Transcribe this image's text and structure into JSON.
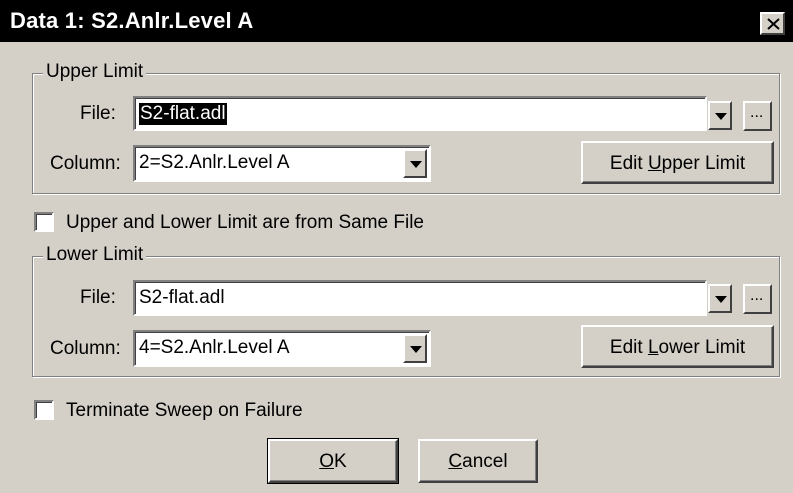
{
  "window": {
    "title": "Data 1: S2.Anlr.Level A",
    "close_icon": "close-icon"
  },
  "upper_limit": {
    "group_title": "Upper Limit",
    "file_label": "File:",
    "file_value": "S2-flat.adl",
    "browse_label": "...",
    "column_label": "Column:",
    "column_value": "2=S2.Anlr.Level A",
    "edit_button": {
      "pre": "Edit ",
      "accel": "U",
      "post": "pper Limit"
    }
  },
  "same_file_checkbox": {
    "label": "Upper and Lower Limit are from Same File",
    "checked": false
  },
  "lower_limit": {
    "group_title": "Lower Limit",
    "file_label": "File:",
    "file_value": "S2-flat.adl",
    "browse_label": "...",
    "column_label": "Column:",
    "column_value": "4=S2.Anlr.Level A",
    "edit_button": {
      "pre": "Edit ",
      "accel": "L",
      "post": "ower Limit"
    }
  },
  "terminate_checkbox": {
    "label": "Terminate Sweep on Failure",
    "checked": false
  },
  "buttons": {
    "ok": {
      "accel": "O",
      "post": "K"
    },
    "cancel": {
      "accel": "C",
      "post": "ancel"
    }
  }
}
